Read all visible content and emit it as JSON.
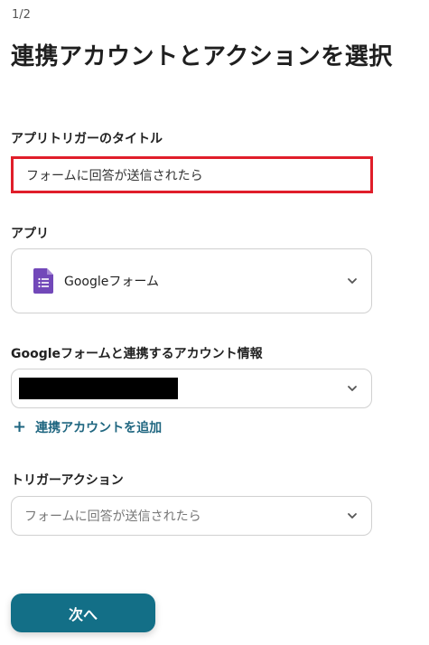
{
  "header": {
    "step": "1/2",
    "title": "連携アカウントとアクションを選択"
  },
  "trigger_title": {
    "label": "アプリトリガーのタイトル",
    "value": "フォームに回答が送信されたら"
  },
  "app": {
    "label": "アプリ",
    "selected": "Googleフォーム",
    "icon": "google-forms-icon",
    "icon_color": "#7248b9"
  },
  "account": {
    "label": "Googleフォームと連携するアカウント情報",
    "add_link": "連携アカウントを追加"
  },
  "trigger_action": {
    "label": "トリガーアクション",
    "selected": "フォームに回答が送信されたら"
  },
  "footer": {
    "next_label": "次へ",
    "button_color": "#136f87"
  },
  "colors": {
    "highlight_border": "#e01e2a",
    "link": "#1f6680"
  }
}
